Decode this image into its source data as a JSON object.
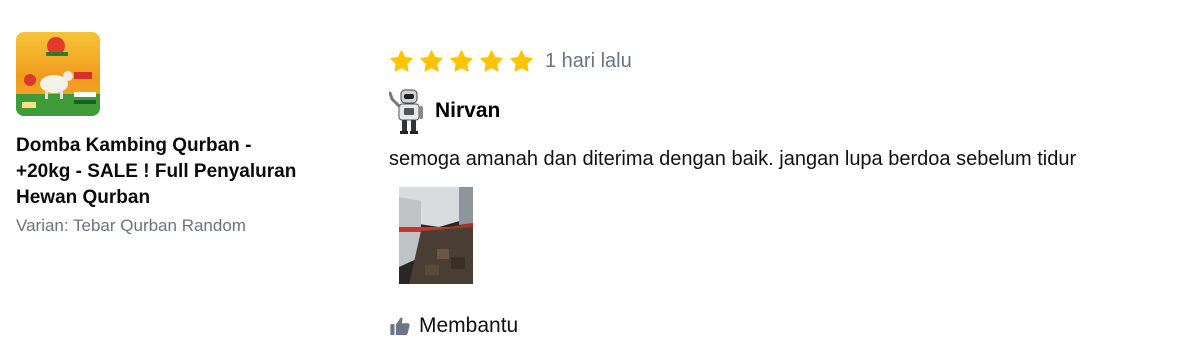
{
  "product": {
    "name": "Domba Kambing Qurban - +20kg - SALE ! Full Penyaluran Hewan Qurban",
    "variant": "Varian: Tebar Qurban Random",
    "thumbnail_icon": "product-photo"
  },
  "review": {
    "rating": 5,
    "rating_max": 5,
    "time": "1 hari lalu",
    "user_name": "Nirvan",
    "text": "semoga amanah dan diterima dengan baik. jangan lupa berdoa sebelum tidur",
    "attachment_icon": "review-photo"
  },
  "actions": {
    "helpful_label": "Membantu"
  },
  "colors": {
    "star": "#FFC400",
    "muted_text": "#6B7280",
    "thumb_icon": "#6D7588"
  }
}
